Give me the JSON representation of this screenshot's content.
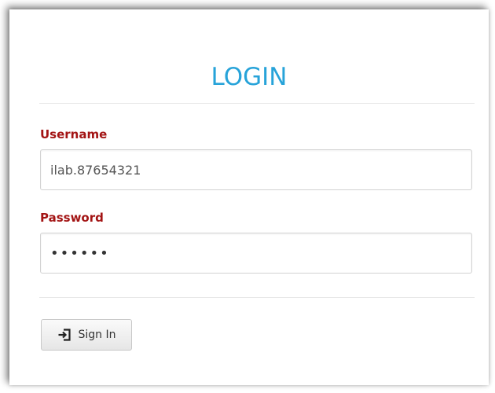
{
  "login": {
    "title": "LOGIN",
    "username_label": "Username",
    "username_value": "ilab.87654321",
    "password_label": "Password",
    "password_value": "••••••",
    "sign_in_label": "Sign In",
    "sign_in_icon": "sign-in-icon"
  },
  "colors": {
    "title": "#27a3d9",
    "label": "#a31414"
  }
}
